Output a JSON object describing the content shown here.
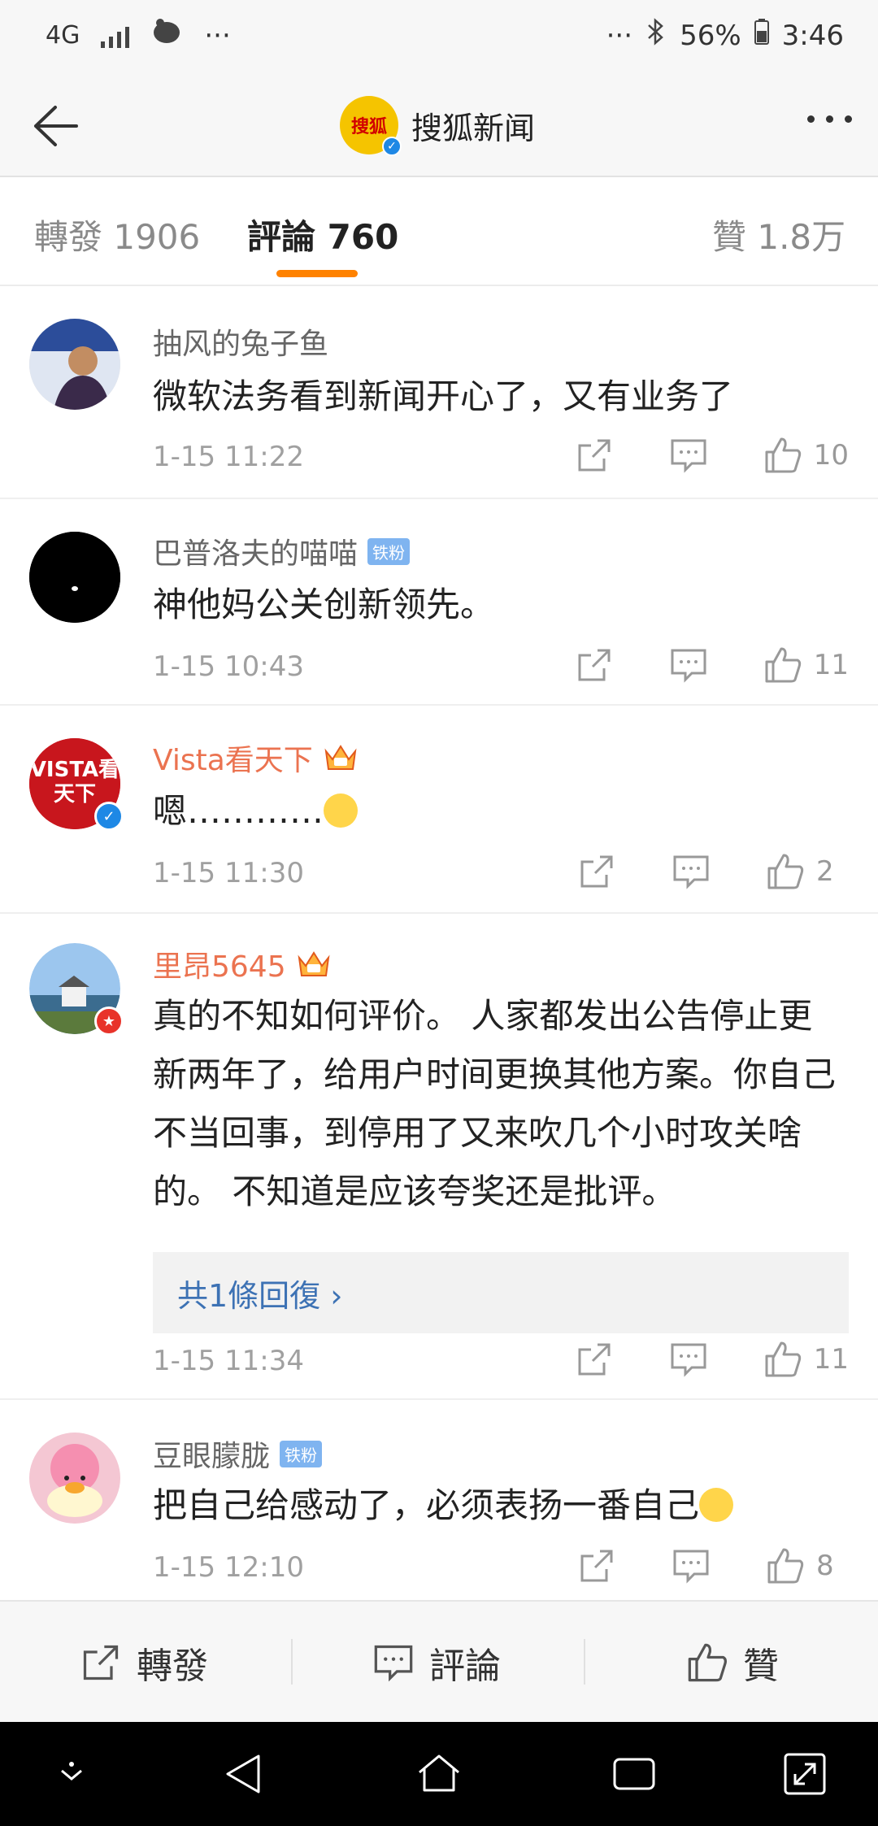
{
  "status_bar": {
    "network": "4G",
    "dots_left": "···",
    "dots_right": "···",
    "battery": "56%",
    "time": "3:46"
  },
  "header": {
    "account_name": "搜狐新闻",
    "avatar_text": "搜狐"
  },
  "tabs": [
    {
      "label": "轉發 1906"
    },
    {
      "label": "評論 760"
    },
    {
      "label": "贊 1.8万"
    }
  ],
  "comments": [
    {
      "name": "抽风的兔子鱼",
      "text": "微软法务看到新闻开心了，又有业务了",
      "time": "1-15 11:22",
      "likes": "10"
    },
    {
      "name": "巴普洛夫的喵喵",
      "badge": "铁粉",
      "text": "神他妈公关创新领先。",
      "time": "1-15 10:43",
      "likes": "11"
    },
    {
      "name": "Vista看天下",
      "avatar_text": "VISTA看天下",
      "text": "嗯…………",
      "time": "1-15 11:30",
      "likes": "2"
    },
    {
      "name": "里昂5645",
      "text": "真的不知如何评价。 人家都发出公告停止更新两年了，给用户时间更换其他方案。你自己不当回事，到停用了又来吹几个小时攻关啥的。 不知道是应该夸奖还是批评。",
      "reply_label": "共1條回復 ›",
      "time": "1-15 11:34",
      "likes": "11"
    },
    {
      "name": "豆眼朦胧",
      "badge": "铁粉",
      "text": "把自己给感动了，必须表扬一番自己",
      "time": "1-15 12:10",
      "likes": "8"
    }
  ],
  "bottom_bar": {
    "repost_label": "轉發",
    "comment_label": "評論",
    "like_label": "贊"
  },
  "colors": {
    "accent": "#ff8200",
    "vip_name": "#eb7350",
    "link": "#3d72b4"
  }
}
